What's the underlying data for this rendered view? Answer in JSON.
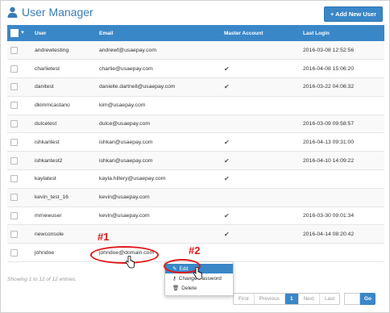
{
  "header": {
    "title": "User Manager",
    "add_button": "+ Add New User"
  },
  "table": {
    "columns": [
      "User",
      "Email",
      "Master Account",
      "Last Login"
    ],
    "rows": [
      {
        "user": "andrewtesting",
        "email": "andrewf@usaepay.com",
        "master": "",
        "last_login": "2016-03-08 12:52:56"
      },
      {
        "user": "charlietest",
        "email": "charlie@usaepay.com",
        "master": "✔",
        "last_login": "2016-04-08 15:06:20"
      },
      {
        "user": "danitest",
        "email": "danielle.dartnell@usaepay.com",
        "master": "✔",
        "last_login": "2016-03-22 04:06:32"
      },
      {
        "user": "dkimmcastano",
        "email": "kim@usaepay.com",
        "master": "",
        "last_login": ""
      },
      {
        "user": "dulcetest",
        "email": "dulce@usaepay.com",
        "master": "",
        "last_login": "2016-03-09 09:58:57"
      },
      {
        "user": "ishkantest",
        "email": "ishkan@usaepay.com",
        "master": "✔",
        "last_login": "2016-04-13 09:31:00"
      },
      {
        "user": "ishkantest2",
        "email": "ishkan@usaepay.com",
        "master": "✔",
        "last_login": "2016-04-10 14:09:22"
      },
      {
        "user": "kaylatest",
        "email": "kayla.hillery@usaepay.com",
        "master": "✔",
        "last_login": ""
      },
      {
        "user": "kevin_test_16",
        "email": "kevin@usaepay.com",
        "master": "",
        "last_login": ""
      },
      {
        "user": "mrnewuser",
        "email": "kevin@usaepay.com",
        "master": "✔",
        "last_login": "2016-03-30 09:01:34"
      },
      {
        "user": "newconsole",
        "email": "",
        "master": "✔",
        "last_login": "2016-04-14 08:20:42"
      },
      {
        "user": "johndoe",
        "email": "johndoe@domain.com",
        "master": "",
        "last_login": ""
      }
    ]
  },
  "footer": {
    "entries_text": "Showing 1 to 12 of 12 entries."
  },
  "pagination": {
    "first": "First",
    "previous": "Previous",
    "current": "1",
    "next": "Next",
    "last": "Last",
    "go": "Go"
  },
  "context_menu": {
    "edit": "Edit",
    "change_password": "Change Password",
    "delete": "Delete"
  },
  "annotations": {
    "step1": "#1",
    "step2": "#2"
  },
  "colors": {
    "accent": "#3a87c8",
    "annotation": "#e01818"
  }
}
